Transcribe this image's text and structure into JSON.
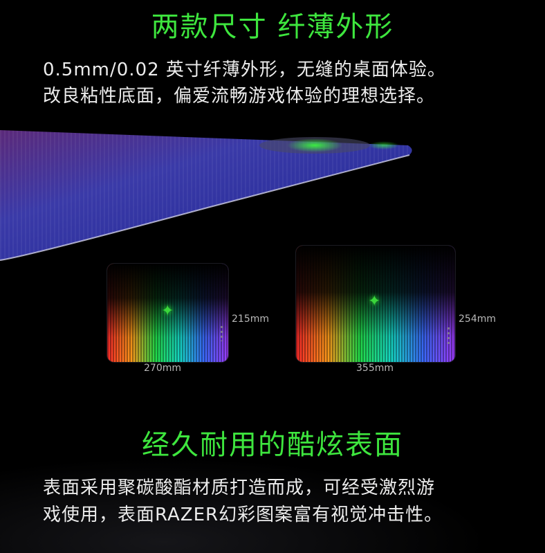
{
  "section1": {
    "title": "两款尺寸 纤薄外形",
    "line1": "0.5mm/0.02 英寸纤薄外形，无缝的桌面体验。",
    "line2": "改良粘性底面，偏爱流畅游戏体验的理想选择。"
  },
  "pads": {
    "small": {
      "height_label": "215mm",
      "width_label": "270mm"
    },
    "large": {
      "height_label": "254mm",
      "width_label": "355mm"
    }
  },
  "section2": {
    "title": "经久耐用的酷炫表面",
    "line1": "表面采用聚碳酸酯材质打造而成，可经受激烈游",
    "line2": "戏使用，表面RAZER幻彩图案富有视觉冲击性。"
  },
  "colors": {
    "title_green": "#3ee63e",
    "background": "#000000"
  }
}
